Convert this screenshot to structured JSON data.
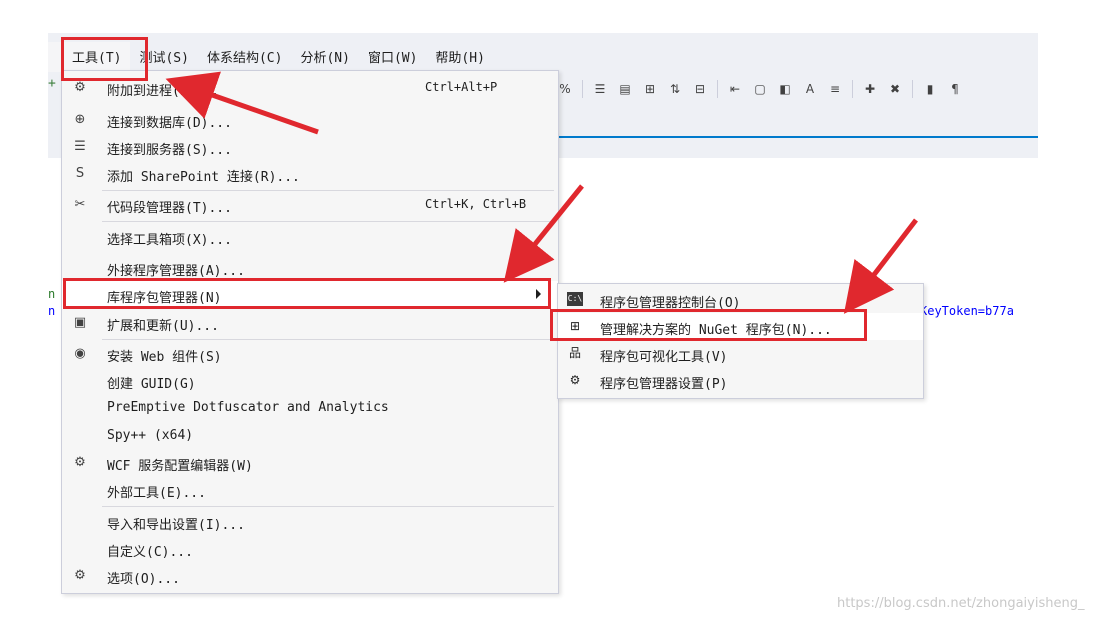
{
  "menubar": [
    "工具(T)",
    "测试(S)",
    "体系结构(C)",
    "分析(N)",
    "窗口(W)",
    "帮助(H)"
  ],
  "code": {
    "left_top": "n",
    "left_bottom": "n",
    "token": "KeyToken=b77a"
  },
  "menu": {
    "items": [
      {
        "icon": "attach-process-icon",
        "glyph": "⚙",
        "label": "附加到进程(P)...",
        "shortcut": "Ctrl+Alt+P"
      },
      {
        "icon": "connect-database-icon",
        "glyph": "⊕",
        "label": "连接到数据库(D)...",
        "shortcut": ""
      },
      {
        "icon": "connect-server-icon",
        "glyph": "☰",
        "label": "连接到服务器(S)...",
        "shortcut": ""
      },
      {
        "icon": "sharepoint-icon",
        "glyph": "S",
        "label": "添加 SharePoint 连接(R)...",
        "shortcut": ""
      },
      {
        "icon": "snippet-manager-icon",
        "glyph": "✂",
        "label": "代码段管理器(T)...",
        "shortcut": "Ctrl+K, Ctrl+B"
      },
      {
        "icon": "",
        "glyph": "",
        "label": "选择工具箱项(X)...",
        "shortcut": ""
      },
      {
        "icon": "",
        "glyph": "",
        "label": "外接程序管理器(A)...",
        "shortcut": ""
      },
      {
        "icon": "",
        "glyph": "",
        "label": "库程序包管理器(N)",
        "shortcut": "",
        "submenu": true
      },
      {
        "icon": "extensions-icon",
        "glyph": "▣",
        "label": "扩展和更新(U)...",
        "shortcut": ""
      },
      {
        "icon": "web-platform-icon",
        "glyph": "◉",
        "label": "安装 Web 组件(S)",
        "shortcut": ""
      },
      {
        "icon": "",
        "glyph": "",
        "label": "创建 GUID(G)",
        "shortcut": ""
      },
      {
        "icon": "",
        "glyph": "",
        "label": "PreEmptive Dotfuscator and Analytics",
        "shortcut": ""
      },
      {
        "icon": "",
        "glyph": "",
        "label": "Spy++ (x64)",
        "shortcut": ""
      },
      {
        "icon": "wcf-config-icon",
        "glyph": "⚙",
        "label": "WCF 服务配置编辑器(W)",
        "shortcut": ""
      },
      {
        "icon": "",
        "glyph": "",
        "label": "外部工具(E)...",
        "shortcut": ""
      },
      {
        "icon": "",
        "glyph": "",
        "label": "导入和导出设置(I)...",
        "shortcut": ""
      },
      {
        "icon": "",
        "glyph": "",
        "label": "自定义(C)...",
        "shortcut": ""
      },
      {
        "icon": "options-gear-icon",
        "glyph": "⚙",
        "label": "选项(O)...",
        "shortcut": ""
      }
    ]
  },
  "submenu": {
    "items": [
      {
        "icon": "package-console-icon",
        "glyph": "C:\\",
        "label": "程序包管理器控制台(O)"
      },
      {
        "icon": "nuget-icon",
        "glyph": "⊞",
        "label": "管理解决方案的 NuGet 程序包(N)..."
      },
      {
        "icon": "package-visualizer-icon",
        "glyph": "品",
        "label": "程序包可视化工具(V)"
      },
      {
        "icon": "package-settings-icon",
        "glyph": "⚙",
        "label": "程序包管理器设置(P)"
      }
    ]
  },
  "watermark": "https://blog.csdn.net/zhongaiyisheng_",
  "colors": {
    "annotation_red": "#e0282e",
    "accent_blue": "#007acc"
  }
}
